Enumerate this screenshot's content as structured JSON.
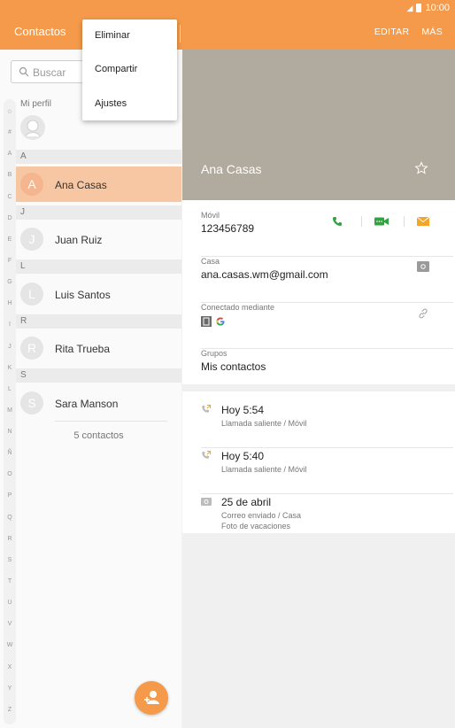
{
  "status": {
    "time": "10:00"
  },
  "appbar": {
    "title": "Contactos",
    "edit": "EDITAR",
    "more": "MÁS"
  },
  "menu": {
    "items": [
      "Eliminar",
      "Compartir",
      "Ajustes"
    ]
  },
  "search": {
    "placeholder": "Buscar"
  },
  "index": [
    "☆",
    "#",
    "A",
    "B",
    "C",
    "D",
    "E",
    "F",
    "G",
    "H",
    "I",
    "J",
    "K",
    "L",
    "M",
    "N",
    "Ñ",
    "O",
    "P",
    "Q",
    "R",
    "S",
    "T",
    "U",
    "V",
    "W",
    "X",
    "Y",
    "Z"
  ],
  "profile": {
    "label": "Mi perfil"
  },
  "sections": [
    {
      "header": "A",
      "contact": {
        "initial": "A",
        "name": "Ana Casas",
        "selected": true
      }
    },
    {
      "header": "J",
      "contact": {
        "initial": "J",
        "name": "Juan Ruiz"
      }
    },
    {
      "header": "L",
      "contact": {
        "initial": "L",
        "name": "Luis Santos"
      }
    },
    {
      "header": "R",
      "contact": {
        "initial": "R",
        "name": "Rita Trueba"
      }
    },
    {
      "header": "S",
      "contact": {
        "initial": "S",
        "name": "Sara Manson"
      }
    }
  ],
  "contacts_count": "5 contactos",
  "detail": {
    "name": "Ana Casas",
    "mobile_label": "Móvil",
    "mobile_value": "123456789",
    "home_label": "Casa",
    "home_value": "ana.casas.wm@gmail.com",
    "connected_label": "Conectado mediante",
    "groups_label": "Grupos",
    "groups_value": "Mis contactos"
  },
  "history": [
    {
      "title": "Hoy 5:54",
      "sub": "Llamada saliente / Móvil"
    },
    {
      "title": "Hoy 5:40",
      "sub": "Llamada saliente / Móvil"
    },
    {
      "title": "25 de abril",
      "sub": "Correo enviado / Casa",
      "sub2": "Foto de vacaciones"
    }
  ],
  "colors": {
    "accent": "#f49a4a",
    "call": "#2fa43f",
    "video": "#2fa43f",
    "mail": "#f4a62a",
    "hero": "#b1aa9e"
  }
}
